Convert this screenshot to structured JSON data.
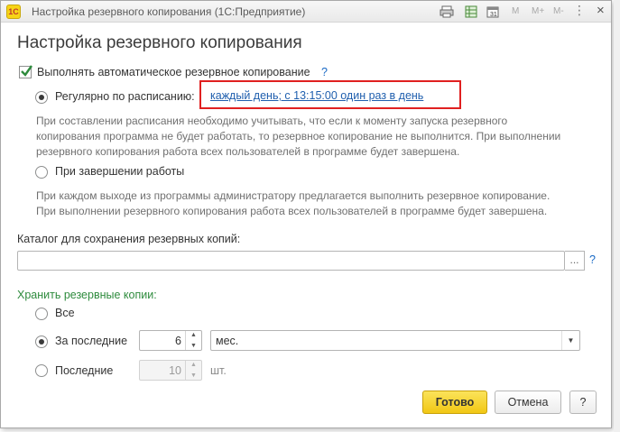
{
  "window": {
    "app_logo": "1С",
    "title": "Настройка резервного копирования  (1С:Предприятие)",
    "toolbar_icons": [
      "print-icon",
      "table-icon",
      "calendar-icon",
      "M",
      "M+",
      "M-",
      "more-icon",
      "close-icon"
    ],
    "toolbar_text": {
      "m": "M",
      "m_plus": "M+",
      "m_minus": "M-",
      "more": "⋮",
      "close": "×"
    }
  },
  "heading": "Настройка резервного копирования",
  "auto_backup": {
    "label": "Выполнять автоматическое резервное копирование",
    "checked": true,
    "help": "?"
  },
  "schedule": {
    "label": "Регулярно по расписанию:",
    "selected": true,
    "link": "каждый день; с 13:15:00 один раз в день",
    "note": [
      "При составлении расписания необходимо учитывать, что если к моменту запуска резервного",
      "копирования программа не будет работать, то резервное копирование не выполнится. При выполнении",
      "резервного копирования работа всех пользователей в программе будет завершена."
    ]
  },
  "on_exit": {
    "label": "При завершении работы",
    "selected": false,
    "note": [
      "При каждом выходе из программы администратору предлагается выполнить резервное копирование.",
      "При выполнении резервного копирования работа всех пользователей в программе будет завершена."
    ]
  },
  "catalog": {
    "label": "Каталог для сохранения резервных копий:",
    "value": "",
    "browse": "...",
    "help": "?"
  },
  "keep": {
    "label": "Хранить резервные копии:",
    "all_label": "Все",
    "last_period_label": "За последние",
    "last_period_value": "6",
    "period_unit": "мес.",
    "last_count_label": "Последние",
    "last_count_value": "10",
    "count_unit": "шт.",
    "selected": "last_period"
  },
  "buttons": {
    "ok": "Готово",
    "cancel": "Отмена",
    "help": "?"
  },
  "colors": {
    "accent_link": "#1f5fae",
    "highlight_box": "#e02020",
    "section_green": "#2e8b3d",
    "ok_button": "#f1c714"
  }
}
